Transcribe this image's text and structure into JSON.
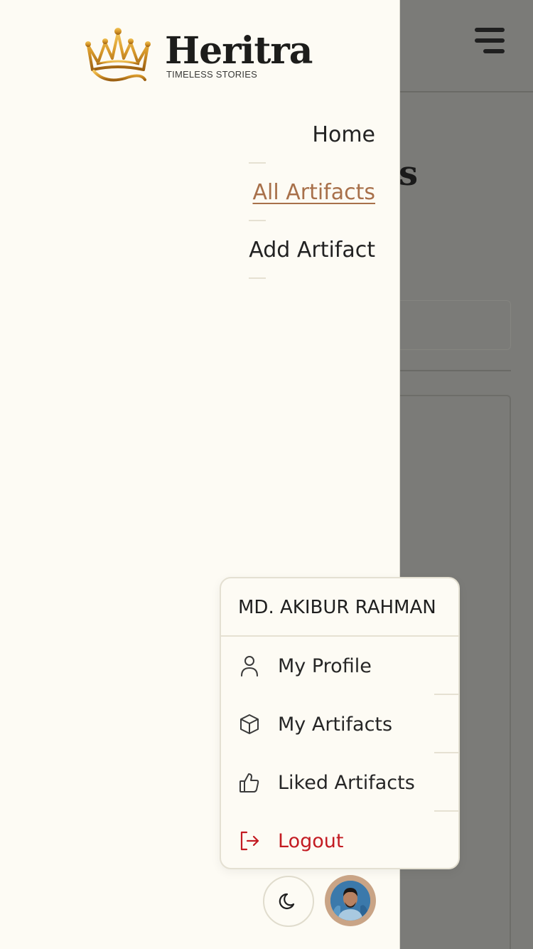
{
  "brand": {
    "name": "Heritra",
    "tagline": "TIMELESS STORIES"
  },
  "background": {
    "title_fragment": "s"
  },
  "nav": {
    "items": [
      {
        "label": "Home",
        "active": false
      },
      {
        "label": "All Artifacts",
        "active": true
      },
      {
        "label": "Add Artifact",
        "active": false
      }
    ]
  },
  "user_menu": {
    "user_name": "MD. AKIBUR RAHMAN",
    "items": [
      {
        "label": "My Profile",
        "icon": "user-icon"
      },
      {
        "label": "My Artifacts",
        "icon": "box-icon"
      },
      {
        "label": "Liked Artifacts",
        "icon": "thumbs-up-icon"
      },
      {
        "label": "Logout",
        "icon": "logout-icon"
      }
    ]
  },
  "colors": {
    "accent": "#a8704a",
    "danger": "#c31b22",
    "drawer_bg": "#fdfbf4",
    "overlay": "#7b7b78"
  }
}
